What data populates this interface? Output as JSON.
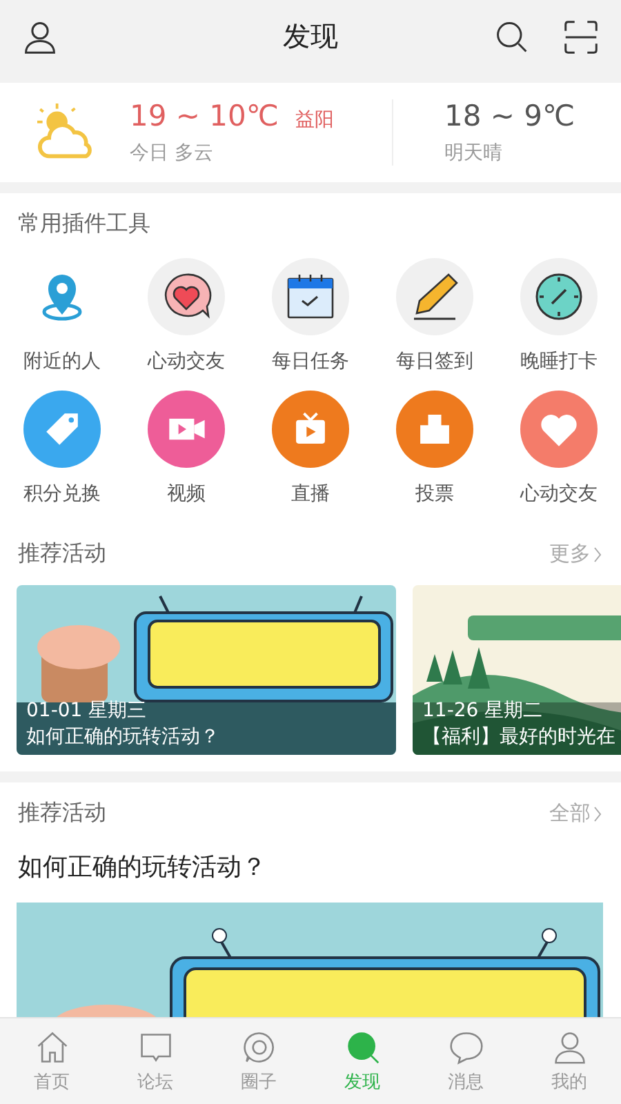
{
  "header": {
    "title": "发现"
  },
  "weather": {
    "today_temp": "19 ~ 10℃",
    "city": "益阳",
    "today_desc": "今日 多云",
    "tomorrow_temp": "18 ~ 9℃",
    "tomorrow_desc": "明天晴"
  },
  "plugins": {
    "title": "常用插件工具",
    "items": [
      {
        "label": "附近的人",
        "kind": "plain"
      },
      {
        "label": "心动交友",
        "kind": "soft"
      },
      {
        "label": "每日任务",
        "kind": "soft"
      },
      {
        "label": "每日签到",
        "kind": "soft"
      },
      {
        "label": "晚睡打卡",
        "kind": "soft"
      },
      {
        "label": "积分兑换",
        "kind": "bold",
        "color": "#3aa8ee"
      },
      {
        "label": "视频",
        "kind": "bold",
        "color": "#ee5d98"
      },
      {
        "label": "直播",
        "kind": "bold",
        "color": "#ee7a1e"
      },
      {
        "label": "投票",
        "kind": "bold",
        "color": "#ee7a1e"
      },
      {
        "label": "心动交友",
        "kind": "bold",
        "color": "#f47c6a"
      }
    ]
  },
  "activities": {
    "title": "推荐活动",
    "more": "更多",
    "cards": [
      {
        "date": "01-01 星期三",
        "title": "如何正确的玩转活动？"
      },
      {
        "date": "11-26 星期二",
        "title": "【福利】最好的时光在"
      }
    ]
  },
  "featured": {
    "title": "推荐活动",
    "more": "全部",
    "headline": "如何正确的玩转活动？"
  },
  "tabs": [
    {
      "label": "首页",
      "selected": false
    },
    {
      "label": "论坛",
      "selected": false
    },
    {
      "label": "圈子",
      "selected": false
    },
    {
      "label": "发现",
      "selected": true
    },
    {
      "label": "消息",
      "selected": false
    },
    {
      "label": "我的",
      "selected": false
    }
  ]
}
